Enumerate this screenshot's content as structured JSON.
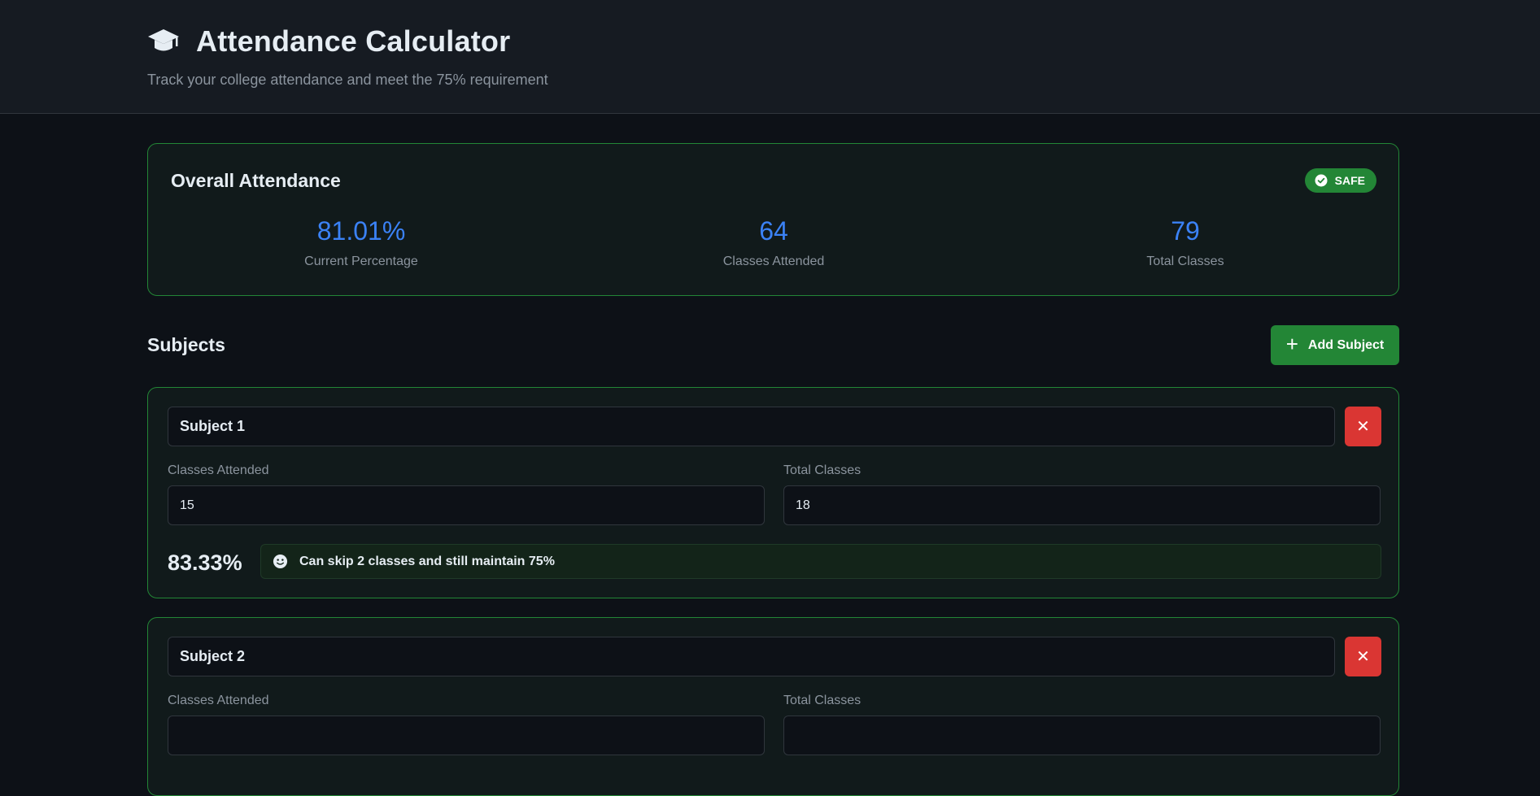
{
  "header": {
    "icon": "graduation-cap-icon",
    "title": "Attendance Calculator",
    "subtitle": "Track your college attendance and meet the 75% requirement"
  },
  "overall": {
    "title": "Overall Attendance",
    "badge": {
      "icon": "check-circle-icon",
      "label": "SAFE",
      "color": "#238636"
    },
    "stats": [
      {
        "value": "81.01%",
        "label": "Current Percentage"
      },
      {
        "value": "64",
        "label": "Classes Attended"
      },
      {
        "value": "79",
        "label": "Total Classes"
      }
    ]
  },
  "subjects": {
    "title": "Subjects",
    "add_button": {
      "icon": "plus-icon",
      "label": "Add Subject"
    },
    "attended_label": "Classes Attended",
    "total_label": "Total Classes",
    "items": [
      {
        "name": "Subject 1",
        "attended": "15",
        "total": "18",
        "percentage": "83.33%",
        "message_icon": "smile-icon",
        "message": "Can skip 2 classes and still maintain 75%"
      },
      {
        "name": "Subject 2",
        "attended": "",
        "total": ""
      }
    ]
  },
  "colors": {
    "background": "#0d1117",
    "accent_blue": "#3b82f6",
    "safe_green": "#238636",
    "danger_red": "#da3633"
  }
}
